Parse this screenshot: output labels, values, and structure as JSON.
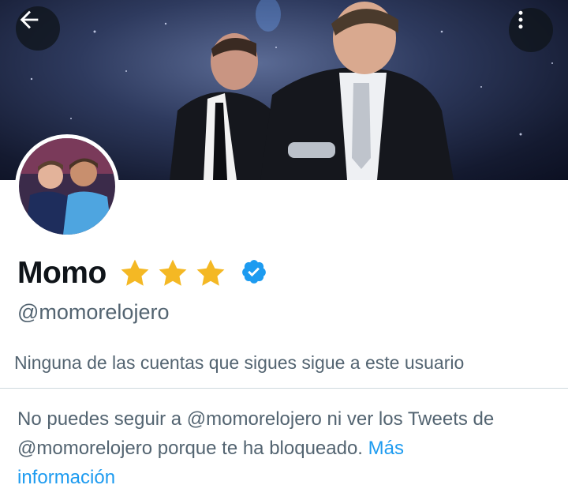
{
  "header": {
    "back_icon": "arrow-left-icon",
    "more_icon": "more-vertical-icon"
  },
  "profile": {
    "display_name": "Momo",
    "handle": "@momorelojero",
    "badges": [
      "star-icon",
      "star-icon",
      "star-icon",
      "verified-badge-icon"
    ],
    "followers_you_know": "Ninguna de las cuentas que sigues sigue a este usuario"
  },
  "blocked_notice": {
    "text": "No puedes seguir a @momorelojero ni ver los Tweets de @momorelojero porque te ha bloqueado. ",
    "link_label": "Más información"
  },
  "colors": {
    "accent": "#1d9bf0",
    "star": "#f4b824",
    "secondary_text": "#536471"
  }
}
